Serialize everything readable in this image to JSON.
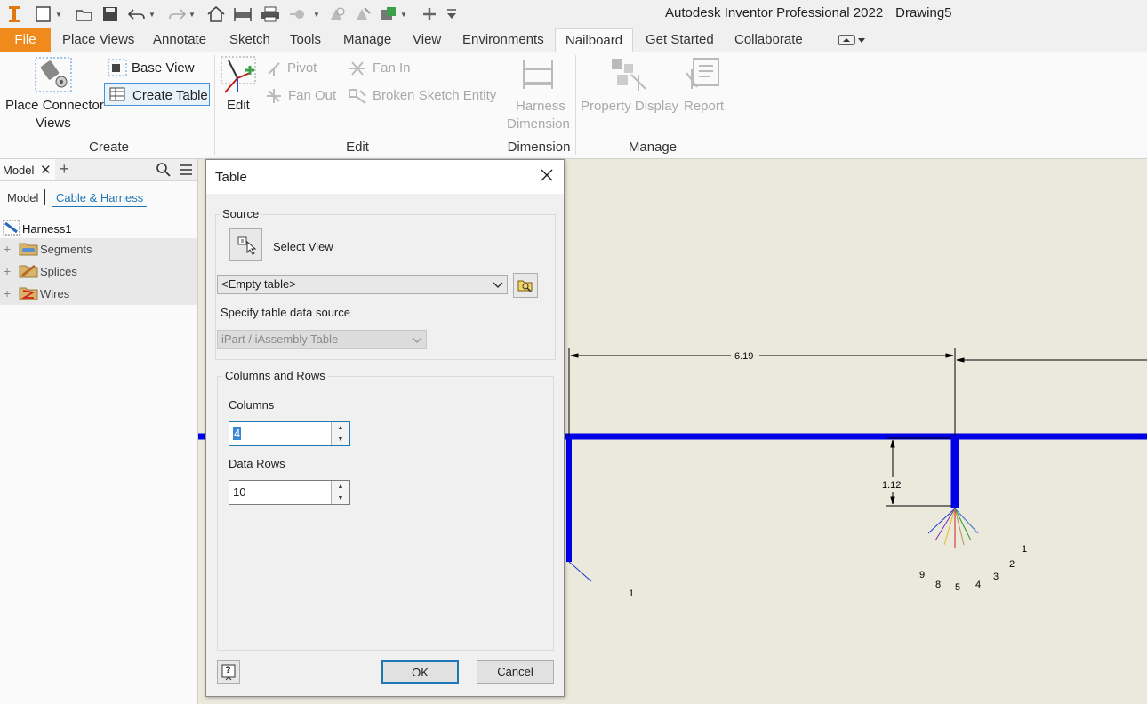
{
  "app": {
    "title": "Autodesk Inventor Professional 2022",
    "document": "Drawing5"
  },
  "tabs": {
    "file": "File",
    "items": [
      "Place Views",
      "Annotate",
      "Sketch",
      "Tools",
      "Manage",
      "View",
      "Environments",
      "Nailboard",
      "Get Started",
      "Collaborate"
    ],
    "active": "Nailboard"
  },
  "ribbon": {
    "create": {
      "place_connector_line1": "Place Connector",
      "place_connector_line2": "Views",
      "base_view": "Base View",
      "create_table": "Create Table",
      "group": "Create"
    },
    "edit": {
      "edit": "Edit",
      "pivot": "Pivot",
      "fan_out": "Fan Out",
      "fan_in": "Fan In",
      "broken_sketch_entity": "Broken Sketch Entity",
      "group": "Edit"
    },
    "dimension": {
      "harness_dimension_line1": "Harness",
      "harness_dimension_line2": "Dimension",
      "group": "Dimension"
    },
    "manage": {
      "property_display": "Property Display",
      "report": "Report",
      "group": "Manage"
    }
  },
  "browser": {
    "tab": "Model",
    "subtabs": [
      "Model",
      "Cable & Harness"
    ],
    "root": "Harness1",
    "items": [
      "Segments",
      "Splices",
      "Wires"
    ]
  },
  "dialog": {
    "title": "Table",
    "source_legend": "Source",
    "select_view": "Select View",
    "table_combo": "<Empty table>",
    "specify_source": "Specify table data source",
    "source_type": "iPart / iAssembly Table",
    "cols_rows_legend": "Columns and Rows",
    "columns_label": "Columns",
    "columns_value": "4",
    "rows_label": "Data Rows",
    "rows_value": "10",
    "ok": "OK",
    "cancel": "Cancel",
    "help": "?"
  },
  "drawing": {
    "dim_horizontal": "6.19",
    "dim_vertical": "1.12",
    "left_pin": "1",
    "pins": [
      "1",
      "2",
      "3",
      "4",
      "5",
      "8",
      "9"
    ]
  },
  "colors": {
    "file_tab": "#f08a1c",
    "segment": "#0000e6",
    "sheet": "#ebe9dc",
    "accent": "#1f77b4"
  }
}
